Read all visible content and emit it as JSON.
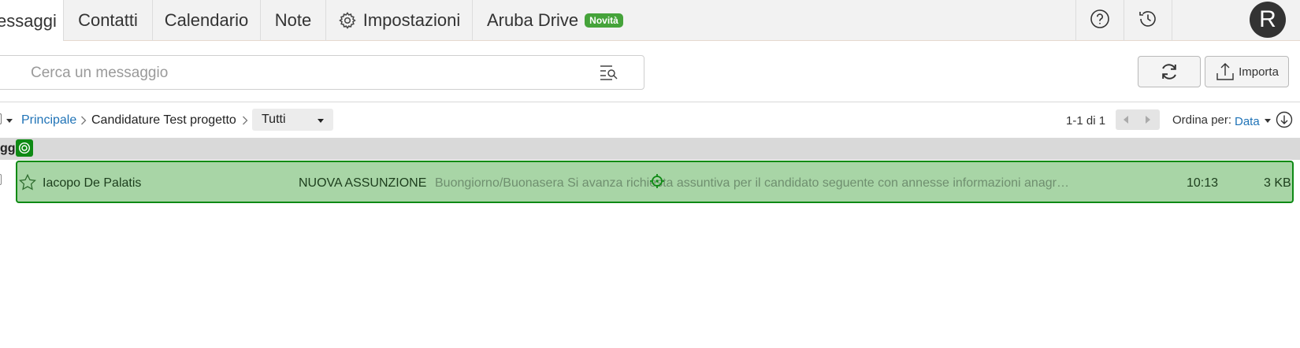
{
  "nav": {
    "tabs": [
      {
        "label": "essaggi"
      },
      {
        "label": "Contatti"
      },
      {
        "label": "Calendario"
      },
      {
        "label": "Note"
      },
      {
        "label": "Impostazioni",
        "icon": "gear-icon"
      },
      {
        "label": "Aruba Drive",
        "badge": "Novità"
      }
    ],
    "avatar_initial": "R"
  },
  "search": {
    "placeholder": "Cerca un messaggio",
    "value": ""
  },
  "toolbar": {
    "refresh_icon": "refresh-icon",
    "import_label": "Importa"
  },
  "breadcrumb": {
    "root": "Principale",
    "folder": "Candidature Test progetto",
    "filter": "Tutti"
  },
  "pagination": {
    "range": "1-1 di 1"
  },
  "sort": {
    "label": "Ordina per:",
    "value": "Data"
  },
  "list_header": {
    "label": "gg"
  },
  "messages": [
    {
      "sender": "Iacopo De Palatis",
      "subject": "NUOVA ASSUNZIONE",
      "preview": "Buongiorno/Buonasera Si avanza richiesta assuntiva per il candidato seguente con annesse informazioni anagr…",
      "time": "10:13",
      "size": "3 KB",
      "starred": false
    }
  ],
  "colors": {
    "highlight_fill": "#a8d5a6",
    "highlight_border": "#0e8a14",
    "link": "#1f73b7",
    "badge": "#45a33a"
  }
}
